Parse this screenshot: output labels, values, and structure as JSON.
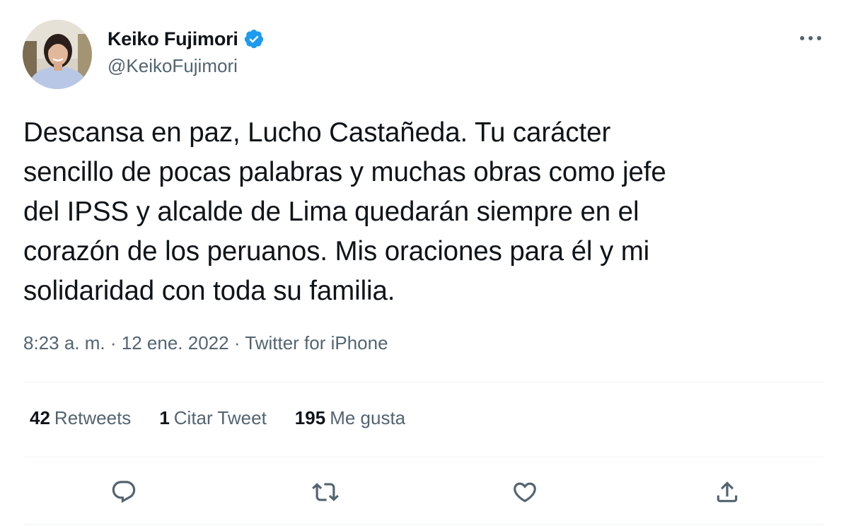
{
  "author": {
    "display_name": "Keiko Fujimori",
    "handle": "@KeikoFujimori",
    "verified": true
  },
  "tweet": {
    "text": "Descansa en paz, Lucho Castañeda. Tu carácter\nsencillo de pocas palabras y muchas obras como jefe\ndel IPSS y alcalde de Lima quedarán siempre en el\ncorazón de los peruanos. Mis oraciones para él y mi\nsolidaridad con toda su familia.",
    "time": "8:23 a. m.",
    "separator": "·",
    "date": "12 ene. 2022",
    "source": "Twitter for iPhone"
  },
  "stats": [
    {
      "count": "42",
      "label": "Retweets"
    },
    {
      "count": "1",
      "label": "Citar Tweet"
    },
    {
      "count": "195",
      "label": "Me gusta"
    }
  ],
  "icons": {
    "more": "more-horizontal-icon",
    "reply": "reply-icon",
    "retweet": "retweet-icon",
    "like": "heart-icon",
    "share": "share-icon",
    "verified": "verified-badge-icon"
  },
  "colors": {
    "verified_blue": "#1d9bf0",
    "text_primary": "#0f1419",
    "text_secondary": "#536471",
    "divider": "#eff3f4"
  }
}
